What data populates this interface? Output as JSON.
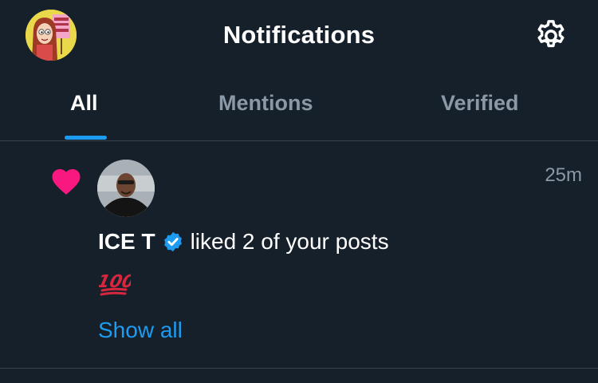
{
  "header": {
    "title": "Notifications",
    "profile_avatar_icon": "profile-avatar",
    "settings_icon": "gear-icon"
  },
  "tabs": [
    {
      "label": "All",
      "active": true
    },
    {
      "label": "Mentions",
      "active": false
    },
    {
      "label": "Verified",
      "active": false
    }
  ],
  "notification": {
    "icon": "heart-icon",
    "icon_color": "#f91880",
    "timestamp": "25m",
    "user_name": "ICE T",
    "verified": true,
    "verified_color": "#1d9bf0",
    "action_text": "liked 2 of your posts",
    "emoji": "💯",
    "show_all_label": "Show all"
  },
  "colors": {
    "background": "#15202b",
    "accent": "#1d9bf0",
    "muted_text": "#8b98a5",
    "divider": "#38444d"
  }
}
